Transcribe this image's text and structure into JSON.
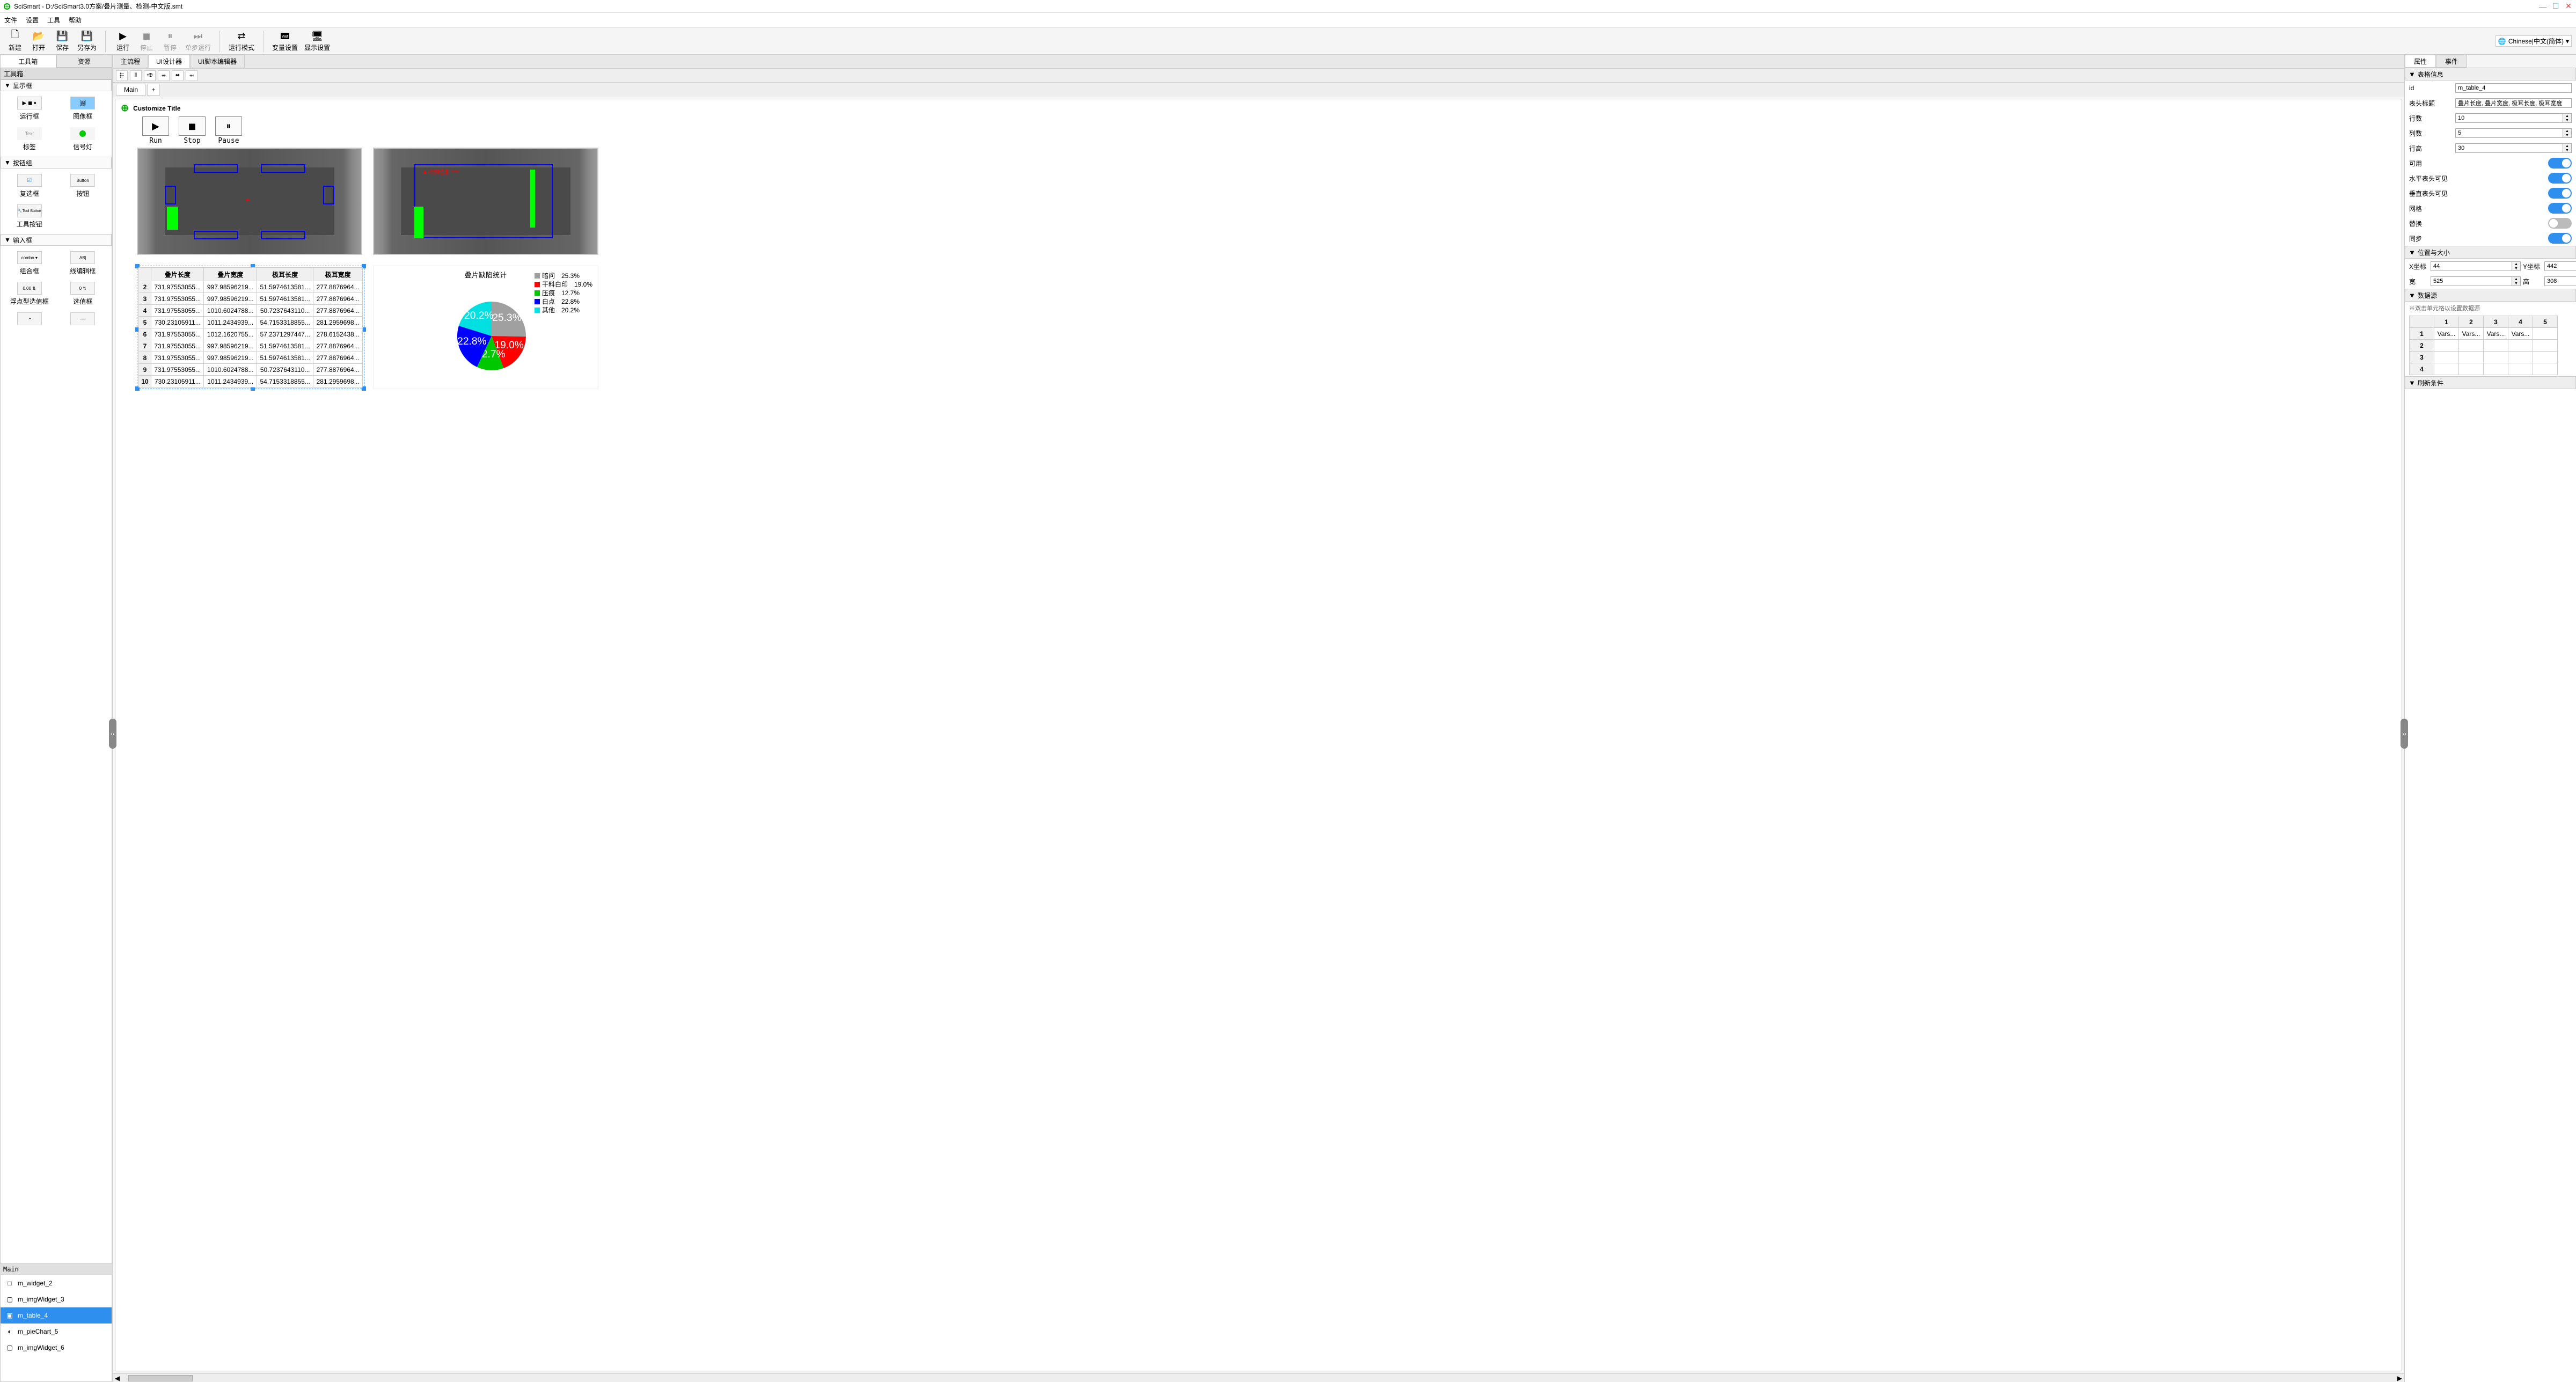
{
  "title": "SciSmart - D:/SciSmart3.0方案/叠片测量、检测-中文版.smt",
  "menu": [
    "文件",
    "设置",
    "工具",
    "帮助"
  ],
  "toolbar": {
    "new": "新建",
    "open": "打开",
    "save": "保存",
    "saveas": "另存为",
    "run": "运行",
    "stop": "停止",
    "pause": "暂停",
    "step": "单步运行",
    "runmode": "运行模式",
    "varset": "变量设置",
    "dispset": "显示设置",
    "lang": "Chinese|中文(简体)"
  },
  "left_tabs": {
    "toolbox": "工具箱",
    "resource": "资源"
  },
  "panel_toolbox": "工具箱",
  "toolbox_groups": {
    "display": "显示框",
    "display_items": {
      "runframe": "运行框",
      "imgframe": "图像框",
      "label": "标签",
      "signal": "信号灯"
    },
    "button": "按钮组",
    "button_items": {
      "checkbox": "复选框",
      "button": "按钮",
      "toolbtn": "工具按钮"
    },
    "input": "输入框",
    "input_items": {
      "combo": "组合框",
      "lineedit": "线编辑框",
      "floatspin": "浮点型选值框",
      "spin": "选值框"
    }
  },
  "main_hdr": "Main",
  "tree": [
    {
      "k": "m_widget_2",
      "ico": "□"
    },
    {
      "k": "m_imgWidget_3",
      "ico": "▢"
    },
    {
      "k": "m_table_4",
      "ico": "▣",
      "sel": true
    },
    {
      "k": "m_pieChart_5",
      "ico": "◐"
    },
    {
      "k": "m_imgWidget_6",
      "ico": "▢"
    }
  ],
  "center_tabs": {
    "main": "主流程",
    "ui": "UI设计器",
    "script": "UI脚本编辑器"
  },
  "page_tab": "Main",
  "ui_title": "Customize Title",
  "run_btns": {
    "run": "Run",
    "stop": "Stop",
    "pause": "Pause"
  },
  "table": {
    "headers": [
      "叠片长度",
      "叠片宽度",
      "极耳长度",
      "极耳宽度"
    ],
    "rows": [
      [
        "2",
        "731.97553055...",
        "997.98596219...",
        "51.5974613581...",
        "277.8876964..."
      ],
      [
        "3",
        "731.97553055...",
        "997.98596219...",
        "51.5974613581...",
        "277.8876964..."
      ],
      [
        "4",
        "731.97553055...",
        "1010.6024788...",
        "50.7237643110...",
        "277.8876964..."
      ],
      [
        "5",
        "730.23105911...",
        "1011.2434939...",
        "54.7153318855...",
        "281.2959698..."
      ],
      [
        "6",
        "731.97553055...",
        "1012.1620755...",
        "57.2371297447...",
        "278.6152438..."
      ],
      [
        "7",
        "731.97553055...",
        "997.98596219...",
        "51.5974613581...",
        "277.8876964..."
      ],
      [
        "8",
        "731.97553055...",
        "997.98596219...",
        "51.5974613581...",
        "277.8876964..."
      ],
      [
        "9",
        "731.97553055...",
        "1010.6024788...",
        "50.7237643110...",
        "277.8876964..."
      ],
      [
        "10",
        "730.23105911...",
        "1011.2434939...",
        "54.7153318855...",
        "281.2959698..."
      ]
    ]
  },
  "chart_data": {
    "type": "pie",
    "title": "叠片缺陷统计",
    "series": [
      {
        "name": "暗问",
        "value": 25.3,
        "color": "#a0a0a0"
      },
      {
        "name": "干料白印",
        "value": 19.0,
        "color": "#ff0000"
      },
      {
        "name": "压痕",
        "value": 12.7,
        "color": "#00c800"
      },
      {
        "name": "白点",
        "value": 22.8,
        "color": "#0000ff"
      },
      {
        "name": "其他",
        "value": 20.2,
        "color": "#00e0e0"
      }
    ]
  },
  "right_tabs": {
    "prop": "属性",
    "event": "事件"
  },
  "sect": {
    "table": "表格信息",
    "pos": "位置与大小",
    "ds": "数据源",
    "refresh": "刷新条件"
  },
  "prop": {
    "id_lbl": "id",
    "id_val": "m_table_4",
    "hdr_lbl": "表头标题",
    "hdr_val": "叠片长度, 叠片宽度, 极耳长度, 极耳宽度",
    "rows_lbl": "行数",
    "rows_val": "10",
    "cols_lbl": "列数",
    "cols_val": "5",
    "rowh_lbl": "行高",
    "rowh_val": "30",
    "enable_lbl": "可用",
    "hhdr_lbl": "水平表头可见",
    "vhdr_lbl": "垂直表头可见",
    "grid_lbl": "网格",
    "alt_lbl": "替换",
    "sync_lbl": "同步",
    "x_lbl": "X坐标",
    "x_val": "44",
    "y_lbl": "Y坐标",
    "y_val": "442",
    "w_lbl": "宽",
    "w_val": "525",
    "h_lbl": "高",
    "h_val": "308",
    "ds_hint": "※双击单元格以设置数据源",
    "ds_cell": "Vars..."
  }
}
